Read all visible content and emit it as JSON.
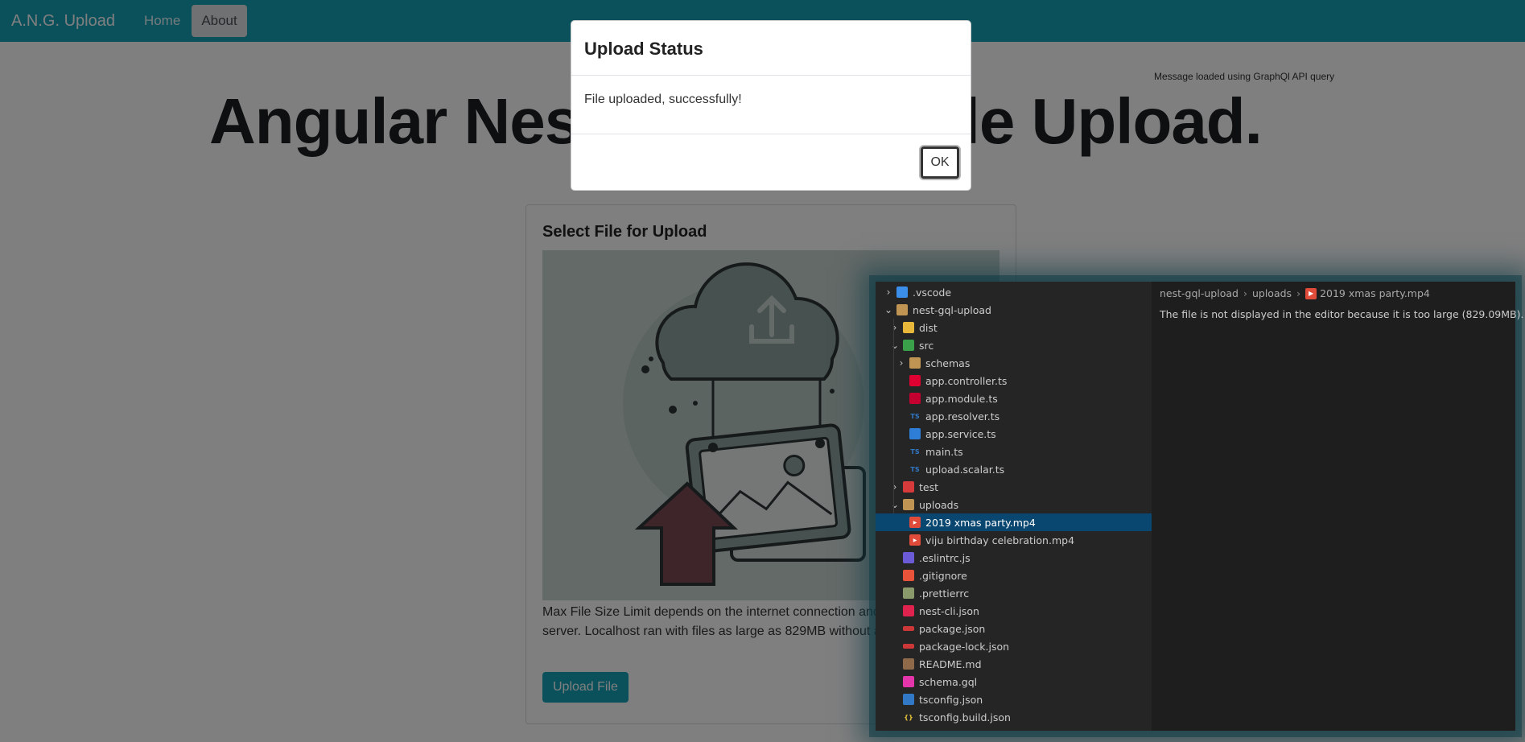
{
  "navbar": {
    "brand": "A.N.G. Upload",
    "links": [
      {
        "label": "Home"
      },
      {
        "label": "About"
      }
    ]
  },
  "api_message": "Message loaded using GraphQl API query",
  "hero": {
    "title": "Angular Nest GraphQL File Upload."
  },
  "card": {
    "title": "Select File for Upload",
    "note": "Max File Size Limit depends on the internet connection and configuration of server. Localhost ran with files as large as 829MB without any problem.",
    "upload_button": "Upload File"
  },
  "modal": {
    "title": "Upload Status",
    "message": "File uploaded, successfully!",
    "ok_label": "OK"
  },
  "editor": {
    "breadcrumb": [
      "nest-gql-upload",
      "uploads",
      "2019 xmas party.mp4"
    ],
    "message": "The file is not displayed in the editor because it is too large (829.09MB).",
    "tree": [
      {
        "name": ".vscode",
        "type": "folder",
        "expanded": false,
        "depth": 0,
        "icon": "vscode-folder-icon",
        "color": "#3b8eea"
      },
      {
        "name": "nest-gql-upload",
        "type": "folder",
        "expanded": true,
        "depth": 0,
        "icon": "folder-open-icon",
        "color": "#c09553"
      },
      {
        "name": "dist",
        "type": "folder",
        "expanded": false,
        "depth": 1,
        "icon": "folder-icon",
        "color": "#e8b83a"
      },
      {
        "name": "src",
        "type": "folder",
        "expanded": true,
        "depth": 1,
        "icon": "src-folder-icon",
        "color": "#3aa04a"
      },
      {
        "name": "schemas",
        "type": "folder",
        "expanded": false,
        "depth": 2,
        "icon": "folder-icon",
        "color": "#c09553"
      },
      {
        "name": "app.controller.ts",
        "type": "file",
        "depth": 2,
        "icon": "angular-icon",
        "color": "#dd0031"
      },
      {
        "name": "app.module.ts",
        "type": "file",
        "depth": 2,
        "icon": "angular-module-icon",
        "color": "#c3002f"
      },
      {
        "name": "app.resolver.ts",
        "type": "file",
        "depth": 2,
        "icon": "typescript-icon",
        "color": "#3178c6"
      },
      {
        "name": "app.service.ts",
        "type": "file",
        "depth": 2,
        "icon": "angular-service-icon",
        "color": "#2e7dd7"
      },
      {
        "name": "main.ts",
        "type": "file",
        "depth": 2,
        "icon": "typescript-icon",
        "color": "#3178c6"
      },
      {
        "name": "upload.scalar.ts",
        "type": "file",
        "depth": 2,
        "icon": "typescript-icon",
        "color": "#3178c6"
      },
      {
        "name": "test",
        "type": "folder",
        "expanded": false,
        "depth": 1,
        "icon": "test-folder-icon",
        "color": "#d63a3a"
      },
      {
        "name": "uploads",
        "type": "folder",
        "expanded": true,
        "depth": 1,
        "icon": "folder-open-icon",
        "color": "#c09553"
      },
      {
        "name": "2019 xmas party.mp4",
        "type": "file",
        "depth": 2,
        "icon": "video-icon",
        "color": "#e04b3a",
        "selected": true
      },
      {
        "name": "viju birthday celebration.mp4",
        "type": "file",
        "depth": 2,
        "icon": "video-icon",
        "color": "#e04b3a"
      },
      {
        "name": ".eslintrc.js",
        "type": "file",
        "depth": 1,
        "icon": "eslint-icon",
        "color": "#6b5bd6"
      },
      {
        "name": ".gitignore",
        "type": "file",
        "depth": 1,
        "icon": "git-icon",
        "color": "#e8533a"
      },
      {
        "name": ".prettierrc",
        "type": "file",
        "depth": 1,
        "icon": "prettier-icon",
        "color": "#8a9a6a"
      },
      {
        "name": "nest-cli.json",
        "type": "file",
        "depth": 1,
        "icon": "nest-icon",
        "color": "#e0234e"
      },
      {
        "name": "package.json",
        "type": "file",
        "depth": 1,
        "icon": "npm-icon",
        "color": "#cb3837"
      },
      {
        "name": "package-lock.json",
        "type": "file",
        "depth": 1,
        "icon": "npm-icon",
        "color": "#cb3837"
      },
      {
        "name": "README.md",
        "type": "file",
        "depth": 1,
        "icon": "markdown-icon",
        "color": "#8f6a4a"
      },
      {
        "name": "schema.gql",
        "type": "file",
        "depth": 1,
        "icon": "graphql-icon",
        "color": "#e535ab"
      },
      {
        "name": "tsconfig.json",
        "type": "file",
        "depth": 1,
        "icon": "tsconfig-icon",
        "color": "#3178c6"
      },
      {
        "name": "tsconfig.build.json",
        "type": "file",
        "depth": 1,
        "icon": "json-icon",
        "color": "#e8c33a"
      }
    ]
  },
  "colors": {
    "navbar": "#17a2b8",
    "selected_row": "#094771",
    "editor_bg": "#1e1e1e",
    "sidebar_bg": "#252526"
  }
}
